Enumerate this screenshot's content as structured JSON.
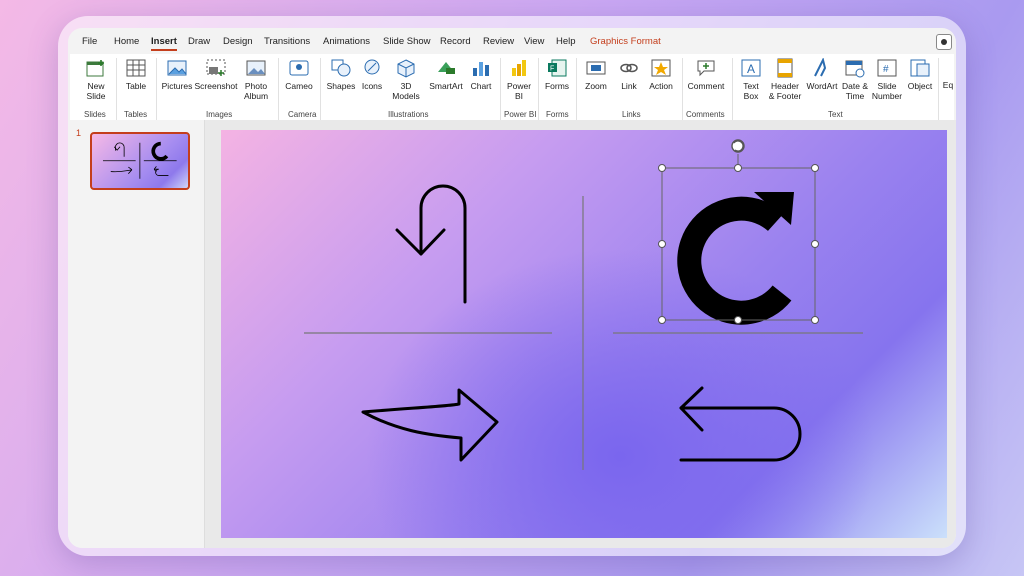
{
  "menu": {
    "tabs": [
      "File",
      "Home",
      "Insert",
      "Draw",
      "Design",
      "Transitions",
      "Animations",
      "Slide Show",
      "Record",
      "Review",
      "View",
      "Help",
      "Graphics Format"
    ],
    "active": "Insert"
  },
  "ribbon": {
    "new_slide": "New\nSlide",
    "table": "Table",
    "pictures": "Pictures",
    "screenshot": "Screenshot",
    "photo_album": "Photo\nAlbum",
    "cameo": "Cameo",
    "shapes": "Shapes",
    "icons": "Icons",
    "models_3d": "3D\nModels",
    "smartart": "SmartArt",
    "chart": "Chart",
    "power_bi": "Power\nBI",
    "forms": "Forms",
    "zoom": "Zoom",
    "link": "Link",
    "action": "Action",
    "comment": "Comment",
    "text_box": "Text\nBox",
    "header_footer": "Header\n& Footer",
    "wordart": "WordArt",
    "date_time": "Date &\nTime",
    "slide_number": "Slide\nNumber",
    "object": "Object",
    "equation": "Eq",
    "groups": {
      "slides": "Slides",
      "tables": "Tables",
      "images": "Images",
      "camera": "Camera",
      "illustrations": "Illustrations",
      "power_bi": "Power BI",
      "forms": "Forms",
      "links": "Links",
      "comments": "Comments",
      "text": "Text"
    }
  },
  "thumbnails": {
    "slide_number": "1"
  },
  "colors": {
    "accent": "#c43e1c",
    "ribbon_bg": "#ffffff",
    "app_bg": "#f3f3f3"
  }
}
